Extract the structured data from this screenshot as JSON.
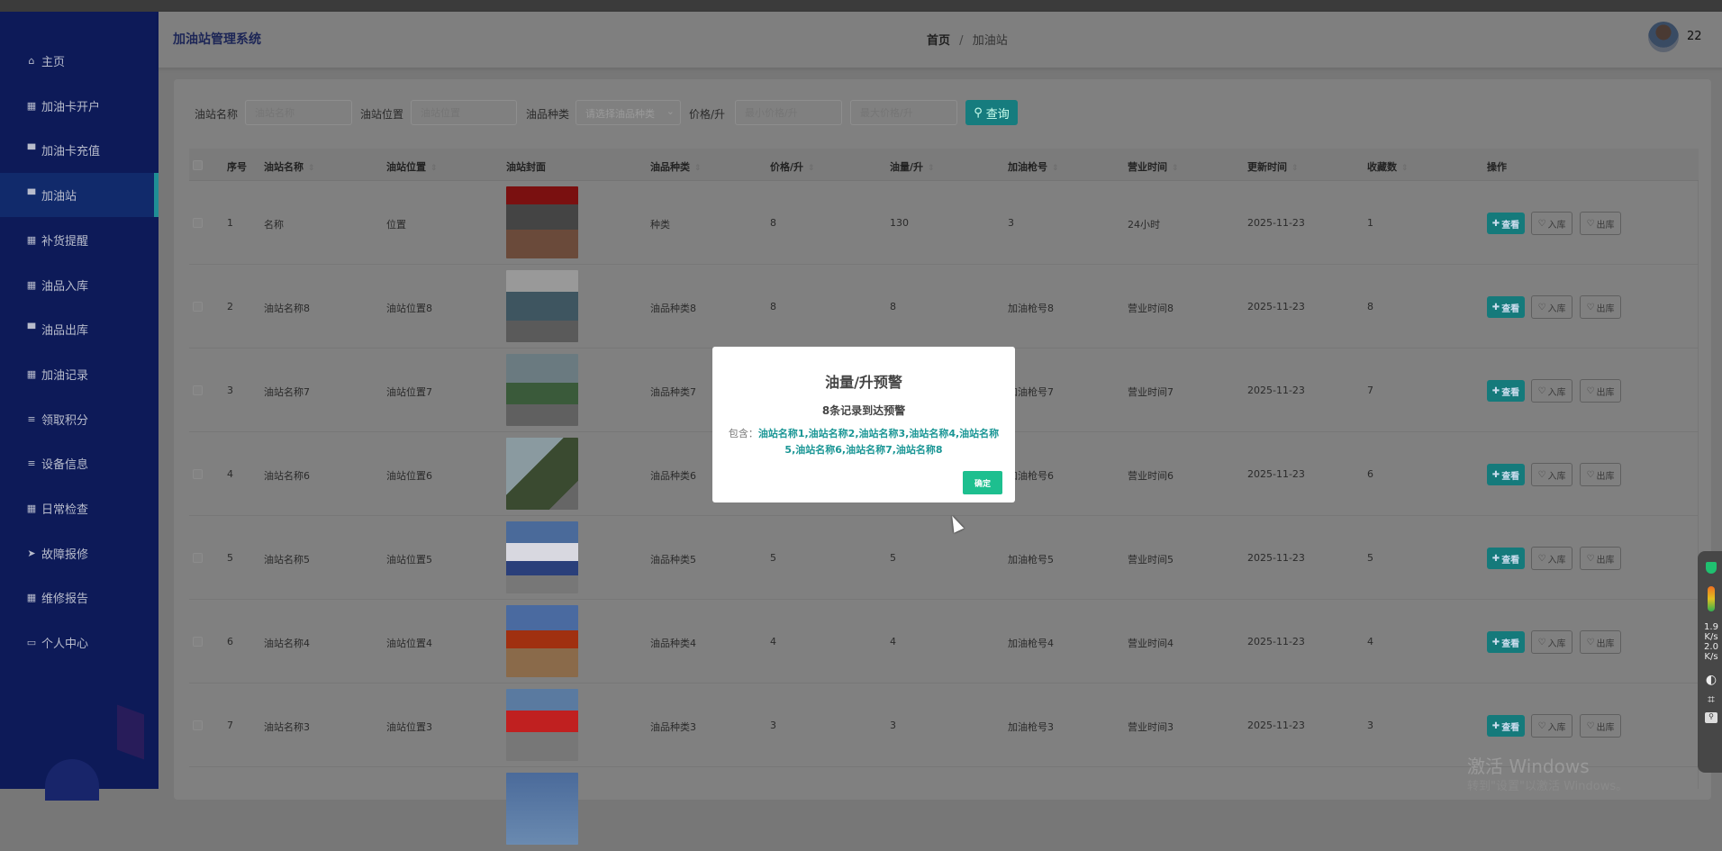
{
  "header": {
    "title": "加油站管理系统",
    "breadcrumb_home": "首页",
    "breadcrumb_sep": "/",
    "breadcrumb_current": "加油站",
    "username": "22"
  },
  "sidebar": {
    "items": [
      {
        "label": "主页",
        "icon": "⌂"
      },
      {
        "label": "加油卡开户",
        "icon": "▦"
      },
      {
        "label": "加油卡充值",
        "icon": "▀"
      },
      {
        "label": "加油站",
        "icon": "▀",
        "active": true
      },
      {
        "label": "补货提醒",
        "icon": "▦"
      },
      {
        "label": "油品入库",
        "icon": "▦"
      },
      {
        "label": "油品出库",
        "icon": "▀"
      },
      {
        "label": "加油记录",
        "icon": "▦"
      },
      {
        "label": "领取积分",
        "icon": "≡"
      },
      {
        "label": "设备信息",
        "icon": "≡"
      },
      {
        "label": "日常检查",
        "icon": "▦"
      },
      {
        "label": "故障报修",
        "icon": "➤"
      },
      {
        "label": "维修报告",
        "icon": "▦"
      },
      {
        "label": "个人中心",
        "icon": "▭"
      }
    ]
  },
  "search": {
    "name_label": "油站名称",
    "name_placeholder": "油站名称",
    "location_label": "油站位置",
    "location_placeholder": "油站位置",
    "type_label": "油品种类",
    "type_placeholder": "请选择油品种类",
    "price_label": "价格/升",
    "min_placeholder": "最小价格/升",
    "max_placeholder": "最大价格/升",
    "query_button": "查询"
  },
  "table": {
    "columns": [
      "序号",
      "油站名称",
      "油站位置",
      "油站封面",
      "油品种类",
      "价格/升",
      "油量/升",
      "加油枪号",
      "营业时间",
      "更新时间",
      "收藏数",
      "操作"
    ],
    "actions": {
      "view": "查看",
      "in": "入库",
      "out": "出库"
    },
    "rows": [
      [
        "1",
        "名称",
        "位置",
        "种类",
        "8",
        "130",
        "3",
        "24小时",
        "2025-11-23",
        "1"
      ],
      [
        "2",
        "油站名称8",
        "油站位置8",
        "油品种类8",
        "8",
        "8",
        "加油枪号8",
        "营业时间8",
        "2025-11-23",
        "8"
      ],
      [
        "3",
        "油站名称7",
        "油站位置7",
        "油品种类7",
        "",
        "",
        "加油枪号7",
        "营业时间7",
        "2025-11-23",
        "7"
      ],
      [
        "4",
        "油站名称6",
        "油站位置6",
        "油品种类6",
        "",
        "",
        "加油枪号6",
        "营业时间6",
        "2025-11-23",
        "6"
      ],
      [
        "5",
        "油站名称5",
        "油站位置5",
        "油品种类5",
        "5",
        "5",
        "加油枪号5",
        "营业时间5",
        "2025-11-23",
        "5"
      ],
      [
        "6",
        "油站名称4",
        "油站位置4",
        "油品种类4",
        "4",
        "4",
        "加油枪号4",
        "营业时间4",
        "2025-11-23",
        "4"
      ],
      [
        "7",
        "油站名称3",
        "油站位置3",
        "油品种类3",
        "3",
        "3",
        "加油枪号3",
        "营业时间3",
        "2025-11-23",
        "3"
      ]
    ]
  },
  "modal": {
    "title": "油量/升预警",
    "subtitle": "8条记录到达预警",
    "prefix": "包含：",
    "names": "油站名称1,油站名称2,油站名称3,油站名称4,油站名称5,油站名称6,油站名称7,油站名称8",
    "ok": "确定"
  },
  "tray": {
    "up_speed": "1.9",
    "down_speed": "2.0",
    "unit": "K/s"
  },
  "watermark": {
    "line1": "激活 Windows",
    "line2": "转到\"设置\"以激活 Windows。"
  },
  "colors": {
    "sidebar": "#0d1a58",
    "accent": "#1a9a9a",
    "ok": "#1dbf8f"
  }
}
